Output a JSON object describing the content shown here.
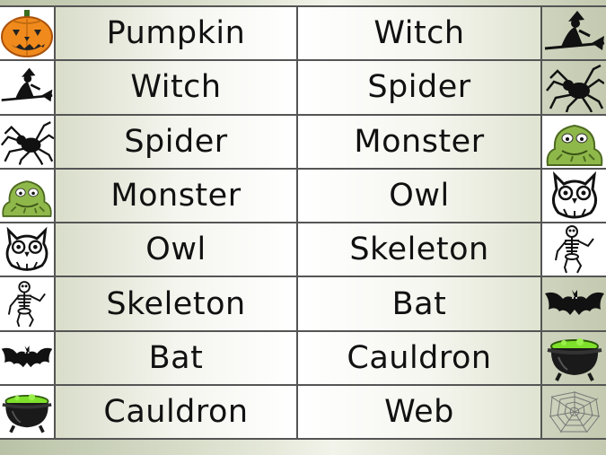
{
  "rows": [
    {
      "left_icon": "pumpkin-icon",
      "left_word": "Pumpkin",
      "right_word": "Witch",
      "right_icon": "witch-icon"
    },
    {
      "left_icon": "witch-icon",
      "left_word": "Witch",
      "right_word": "Spider",
      "right_icon": "spider-icon"
    },
    {
      "left_icon": "spider-icon",
      "left_word": "Spider",
      "right_word": "Monster",
      "right_icon": "monster-icon"
    },
    {
      "left_icon": "monster-icon",
      "left_word": "Monster",
      "right_word": "Owl",
      "right_icon": "owl-icon"
    },
    {
      "left_icon": "owl-icon",
      "left_word": "Owl",
      "right_word": "Skeleton",
      "right_icon": "skeleton-icon"
    },
    {
      "left_icon": "skeleton-icon",
      "left_word": "Skeleton",
      "right_word": "Bat",
      "right_icon": "bat-icon"
    },
    {
      "left_icon": "bat-icon",
      "left_word": "Bat",
      "right_word": "Cauldron",
      "right_icon": "cauldron-icon"
    },
    {
      "left_icon": "cauldron-icon",
      "left_word": "Cauldron",
      "right_word": "Web",
      "right_icon": "web-icon"
    }
  ],
  "colors": {
    "pumpkin": "#f08a1c",
    "monster": "#8fb84a",
    "cauldron_slime": "#7ee02a",
    "silhouette": "#111111"
  }
}
